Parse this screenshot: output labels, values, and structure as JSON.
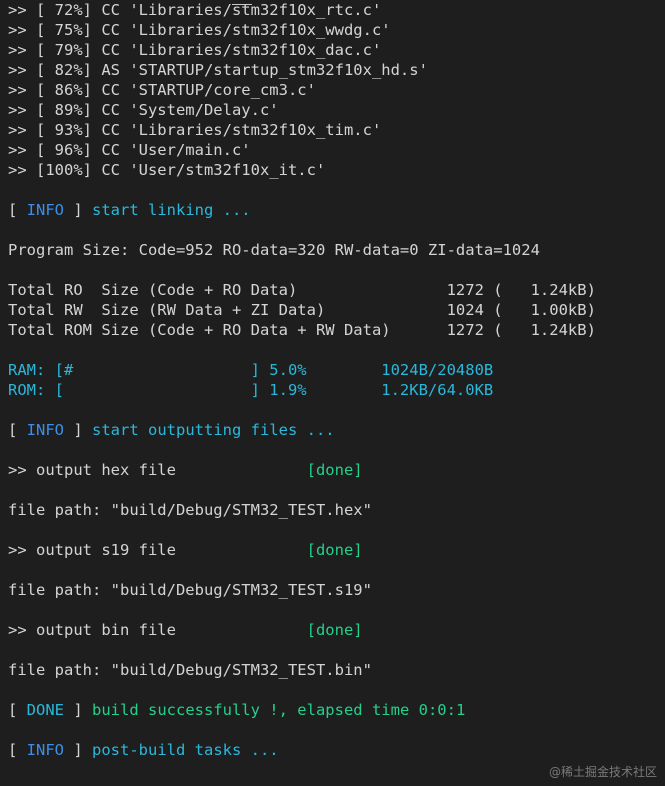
{
  "compile_lines": [
    ">> [ 72%] CC 'Libraries/stm32f10x_rtc.c'",
    ">> [ 75%] CC 'Libraries/stm32f10x_wwdg.c'",
    ">> [ 79%] CC 'Libraries/stm32f10x_dac.c'",
    ">> [ 82%] AS 'STARTUP/startup_stm32f10x_hd.s'",
    ">> [ 86%] CC 'STARTUP/core_cm3.c'",
    ">> [ 89%] CC 'System/Delay.c'",
    ">> [ 93%] CC 'Libraries/stm32f10x_tim.c'",
    ">> [ 96%] CC 'User/main.c'",
    ">> [100%] CC 'User/stm32f10x_it.c'"
  ],
  "info_linking": {
    "open": "[ ",
    "tag": "INFO",
    "close": " ] ",
    "message": "start linking ..."
  },
  "program_size": "Program Size: Code=952 RO-data=320 RW-data=0 ZI-data=1024",
  "totals": [
    "Total RO  Size (Code + RO Data)                1272 (   1.24kB)",
    "Total RW  Size (RW Data + ZI Data)             1024 (   1.00kB)",
    "Total ROM Size (Code + RO Data + RW Data)      1272 (   1.24kB)"
  ],
  "memory": {
    "ram": "RAM: [#                   ] 5.0%        1024B/20480B",
    "rom": "ROM: [                    ] 1.9%        1.2KB/64.0KB",
    "ram_percent": 5.0,
    "rom_percent": 1.9
  },
  "info_output": {
    "open": "[ ",
    "tag": "INFO",
    "close": " ] ",
    "message": "start outputting files ..."
  },
  "outputs": [
    {
      "label": ">> output hex file              ",
      "status": "[done]",
      "path": "file path: \"build/Debug/STM32_TEST.hex\""
    },
    {
      "label": ">> output s19 file              ",
      "status": "[done]",
      "path": "file path: \"build/Debug/STM32_TEST.s19\""
    },
    {
      "label": ">> output bin file              ",
      "status": "[done]",
      "path": "file path: \"build/Debug/STM32_TEST.bin\""
    }
  ],
  "done_line": {
    "open": "[ ",
    "tag": "DONE",
    "close": " ] ",
    "message": "build successfully !, elapsed time 0:0:1"
  },
  "info_post": {
    "open": "[ ",
    "tag": "INFO",
    "close": " ] ",
    "message": "post-build tasks ..."
  },
  "watermark": "@稀土掘金技术社区",
  "colors": {
    "background": "#1e1e1e",
    "text": "#d4d4d4",
    "info_blue": "#3b8eea",
    "cyan": "#29b8db",
    "green": "#23d18b"
  }
}
